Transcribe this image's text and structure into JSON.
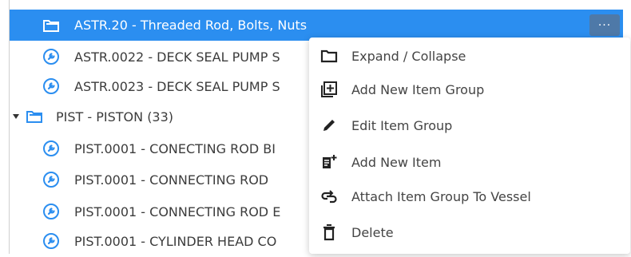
{
  "tree": {
    "selected": {
      "label": "ASTR.20 - Threaded Rod, Bolts, Nuts",
      "more": "···"
    },
    "rows": [
      {
        "label": "ASTR.0022 - DECK SEAL PUMP S"
      },
      {
        "label": "ASTR.0023 - DECK SEAL PUMP S"
      },
      {
        "label": "PIST - PISTON (33)"
      },
      {
        "label": "PIST.0001 - CONECTING ROD BI"
      },
      {
        "label": "PIST.0001 - CONNECTING ROD"
      },
      {
        "label": "PIST.0001 - CONNECTING ROD E"
      },
      {
        "label": "PIST.0001 - CYLINDER HEAD CO"
      }
    ]
  },
  "menu": {
    "items": [
      {
        "label": "Expand / Collapse",
        "icon": "folder-icon"
      },
      {
        "label": "Add New Item Group",
        "icon": "add-group-icon"
      },
      {
        "label": "Edit Item Group",
        "icon": "pencil-icon"
      },
      {
        "label": "Add New Item",
        "icon": "add-item-icon"
      },
      {
        "label": "Attach Item Group To Vessel",
        "icon": "attach-icon"
      },
      {
        "label": "Delete",
        "icon": "trash-icon"
      }
    ]
  },
  "colors": {
    "selection": "#2b8ef0",
    "icon_blue": "#2b8ef0",
    "more_button": "#4e79a8"
  }
}
